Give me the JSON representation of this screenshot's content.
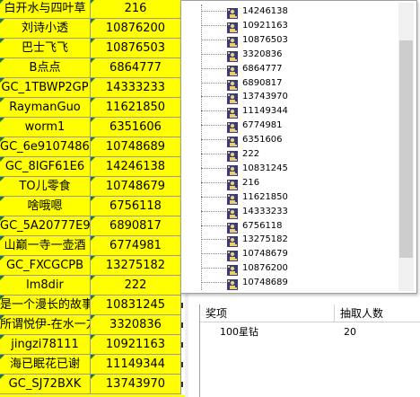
{
  "grid_rows": [
    {
      "name": "白开水与四叶草",
      "id": "216"
    },
    {
      "name": "刘诗小透",
      "id": "10876200"
    },
    {
      "name": "巴士飞飞",
      "id": "10876503"
    },
    {
      "name": "B点点",
      "id": "6864777"
    },
    {
      "name": "GC_1TBWP2GP",
      "id": "14333233"
    },
    {
      "name": "RaymanGuo",
      "id": "11621850"
    },
    {
      "name": "worm1",
      "id": "6351606"
    },
    {
      "name": "GC_6e91074868",
      "id": "10748689"
    },
    {
      "name": "GC_8IGF61E6",
      "id": "14246138"
    },
    {
      "name": "TO儿零食",
      "id": "10748679"
    },
    {
      "name": "啥哦嗯",
      "id": "6756118"
    },
    {
      "name": "GC_5A20777E93",
      "id": "6890817"
    },
    {
      "name": "山巅一寺一壶酒",
      "id": "6774981"
    },
    {
      "name": "GC_FXCGCPB",
      "id": "13275182"
    },
    {
      "name": "lm8dir",
      "id": "222"
    },
    {
      "name": "是一个漫长的故事",
      "id": "10831245"
    },
    {
      "name": "所谓悦伊-在水一方",
      "id": "3320836"
    },
    {
      "name": "jingzi78111",
      "id": "10921163"
    },
    {
      "name": "海已眠花已谢",
      "id": "11149344"
    },
    {
      "name": "GC_SJ72BXK",
      "id": "13743970"
    }
  ],
  "tree_items": [
    "14246138",
    "10921163",
    "10876503",
    "3320836",
    "6864777",
    "6890817",
    "13743970",
    "11149344",
    "6774981",
    "6351606",
    "222",
    "10831245",
    "216",
    "11621850",
    "14333233",
    "6756118",
    "13275182",
    "10748679",
    "10876200",
    "10748689"
  ],
  "prize_table": {
    "headers": [
      "奖项",
      "抽取人数"
    ],
    "rows": [
      {
        "prize": "100星钻",
        "count": "20"
      }
    ]
  },
  "colors": {
    "grid_bg": "#ffff00",
    "tree_icon": "#3a3a7a",
    "corner_mark": "#1f7a3a"
  }
}
